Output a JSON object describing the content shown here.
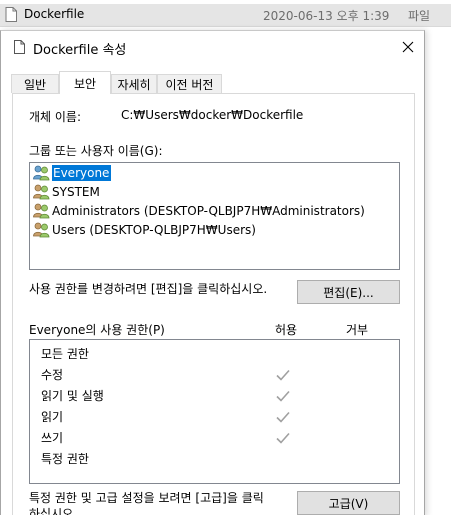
{
  "explorer": {
    "file_name": "Dockerfile",
    "modified": "2020-06-13 오후 1:39",
    "type": "파일"
  },
  "dialog": {
    "title": "Dockerfile 속성",
    "tabs": [
      {
        "label": "일반",
        "active": false
      },
      {
        "label": "보안",
        "active": true
      },
      {
        "label": "자세히",
        "active": false
      },
      {
        "label": "이전 버전",
        "active": false
      }
    ],
    "object_name_label": "개체 이름:",
    "object_name_value": "C:₩Users₩docker₩Dockerfile",
    "groups_label": "그룹 또는 사용자 이름(G):",
    "groups": [
      {
        "name": "Everyone",
        "selected": true
      },
      {
        "name": "SYSTEM",
        "selected": false
      },
      {
        "name": "Administrators (DESKTOP-QLBJP7H₩Administrators)",
        "selected": false
      },
      {
        "name": "Users (DESKTOP-QLBJP7H₩Users)",
        "selected": false
      }
    ],
    "edit_hint": "사용 권한를 변경하려면 [편집]을 클릭하십시오.",
    "edit_button": "편집(E)...",
    "permissions_label": "Everyone의 사용 권한(P)",
    "allow_header": "허용",
    "deny_header": "거부",
    "permissions": [
      {
        "name": "모든 권한",
        "allow": false,
        "deny": false
      },
      {
        "name": "수정",
        "allow": true,
        "deny": false
      },
      {
        "name": "읽기 및 실행",
        "allow": true,
        "deny": false
      },
      {
        "name": "읽기",
        "allow": true,
        "deny": false
      },
      {
        "name": "쓰기",
        "allow": true,
        "deny": false
      },
      {
        "name": "특정 권한",
        "allow": false,
        "deny": false
      }
    ],
    "advanced_hint_line1": "특정 권한 및 고급 설정을 보려면 [고급]을 클릭",
    "advanced_hint_line2": "하십시오.",
    "advanced_button": "고급(V)"
  },
  "colors": {
    "selection": "#0078d7",
    "check_disabled": "#a0a0a0",
    "button_face": "#e1e1e1"
  }
}
